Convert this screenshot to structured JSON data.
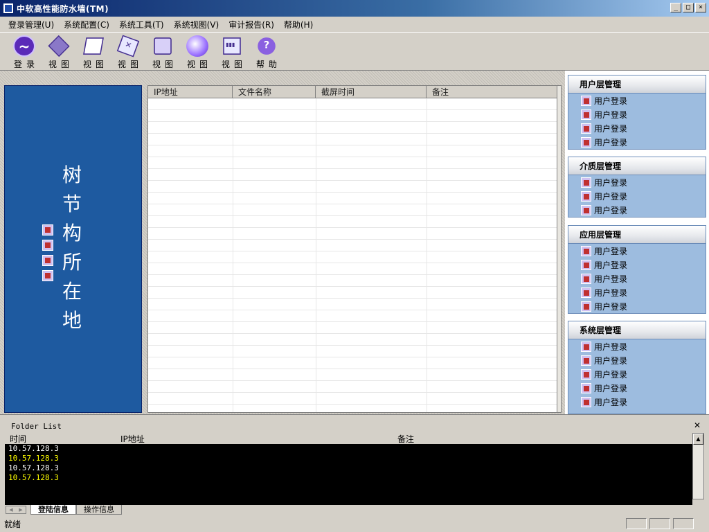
{
  "window": {
    "title": "中软高性能防水墙(TM)"
  },
  "menu": [
    "登录管理(U)",
    "系统配置(C)",
    "系统工具(T)",
    "系统视图(V)",
    "审计报告(R)",
    "帮助(H)"
  ],
  "toolbar": [
    {
      "label": "登录",
      "icon": "login-icon"
    },
    {
      "label": "视图",
      "icon": "view-icon"
    },
    {
      "label": "视图",
      "icon": "view-icon"
    },
    {
      "label": "视图",
      "icon": "view-icon"
    },
    {
      "label": "视图",
      "icon": "view-icon"
    },
    {
      "label": "视图",
      "icon": "view-icon"
    },
    {
      "label": "视图",
      "icon": "view-icon"
    },
    {
      "label": "帮助",
      "icon": "help-icon"
    }
  ],
  "tree": {
    "title": "树节构所在地"
  },
  "grid": {
    "columns": [
      "IP地址",
      "文件名称",
      "截屏时间",
      "备注"
    ]
  },
  "right_panel": {
    "sections": [
      {
        "title": "用户层管理",
        "items": [
          "用户登录",
          "用户登录",
          "用户登录",
          "用户登录"
        ]
      },
      {
        "title": "介质层管理",
        "items": [
          "用户登录",
          "用户登录",
          "用户登录"
        ]
      },
      {
        "title": "应用层管理",
        "items": [
          "用户登录",
          "用户登录",
          "用户登录",
          "用户登录",
          "用户登录"
        ]
      },
      {
        "title": "系统层管理",
        "items": [
          "用户登录",
          "用户登录",
          "用户登录",
          "用户登录",
          "用户登录"
        ]
      }
    ]
  },
  "bottom": {
    "folder_label": "Folder List",
    "columns": [
      "时间",
      "IP地址",
      "备注"
    ],
    "rows": [
      {
        "text": "10.57.128.3",
        "color": "#ffffff"
      },
      {
        "text": "10.57.128.3",
        "color": "#ffff00"
      },
      {
        "text": "10.57.128.3",
        "color": "#ffffff"
      },
      {
        "text": "10.57.128.3",
        "color": "#ffff00"
      }
    ],
    "tabs": [
      "登陆信息",
      "操作信息"
    ]
  },
  "status": {
    "text": "就绪"
  }
}
